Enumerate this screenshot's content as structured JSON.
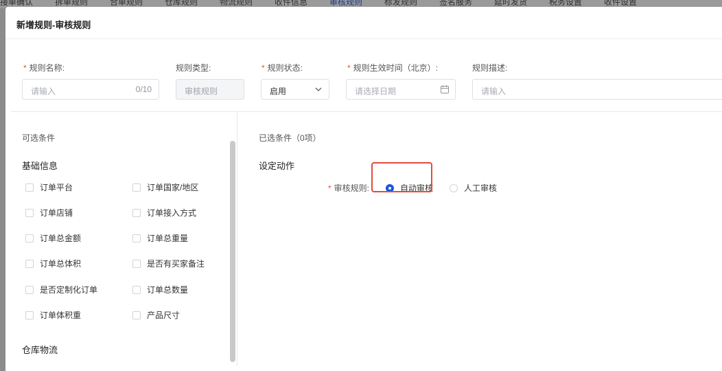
{
  "background_tabs": [
    "接单确认",
    "拆单规则",
    "合单规则",
    "仓库规则",
    "物流规则",
    "收件信息",
    "审核规则",
    "标发规则",
    "签名服务",
    "延时发货",
    "税务设置",
    "收件设置"
  ],
  "dialog": {
    "title": "新增规则-审核规则"
  },
  "form": {
    "name": {
      "label": "规则名称:",
      "placeholder": "请输入",
      "counter": "0/10"
    },
    "type": {
      "label": "规则类型:",
      "value": "审核规则"
    },
    "status": {
      "label": "规则状态:",
      "value": "启用"
    },
    "effective_time": {
      "label": "规则生效时间（北京）:",
      "placeholder": "请选择日期"
    },
    "description": {
      "label": "规则描述:",
      "placeholder": "请输入"
    }
  },
  "left_panel": {
    "title": "可选条件",
    "groups": [
      {
        "title": "基础信息",
        "items": [
          "订单平台",
          "订单国家/地区",
          "订单店铺",
          "订单接入方式",
          "订单总金额",
          "订单总重量",
          "订单总体积",
          "是否有买家备注",
          "是否定制化订单",
          "订单总数量",
          "订单体积重",
          "产品尺寸"
        ]
      },
      {
        "title": "仓库物流",
        "items": []
      }
    ]
  },
  "right_panel": {
    "selected_title": "已选条件（0项）",
    "action_title": "设定动作",
    "audit_rule": {
      "label": "审核规则:",
      "options": [
        {
          "label": "自动审核",
          "selected": true
        },
        {
          "label": "人工审核",
          "selected": false
        }
      ]
    }
  },
  "colors": {
    "accent": "#1a56db",
    "required": "#e74c3c",
    "highlight": "#e24a3b"
  }
}
